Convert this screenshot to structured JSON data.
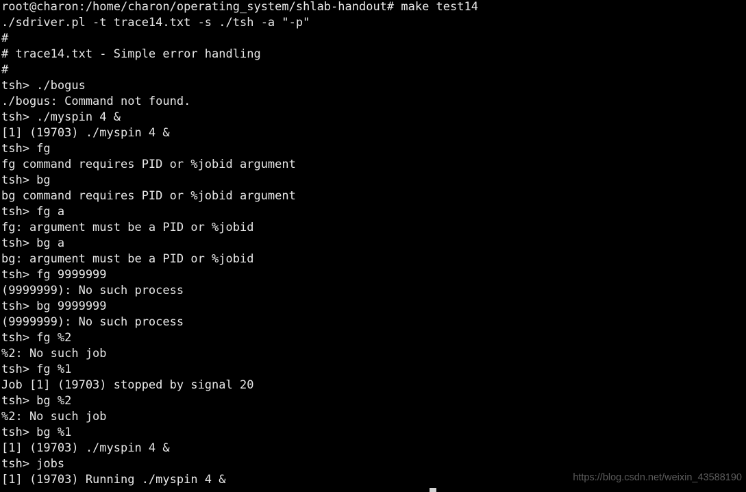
{
  "terminal": {
    "title": "root@charon: /home/charon/operating_system/shlab-handout",
    "colors": {
      "background": "#000000",
      "foreground": "#e8e8e8",
      "cursor": "#d4d4d4",
      "watermark": "#5c5c5c"
    },
    "prompt": "root@charon:/home/charon/operating_system/shlab-handout#",
    "shell_prompt": "tsh>",
    "command": "make test14",
    "job_pid": "19703",
    "job_id": "[1]",
    "lines": [
      "root@charon:/home/charon/operating_system/shlab-handout# make test14",
      "./sdriver.pl -t trace14.txt -s ./tsh -a \"-p\"",
      "#",
      "# trace14.txt - Simple error handling",
      "#",
      "tsh> ./bogus",
      "./bogus: Command not found.",
      "tsh> ./myspin 4 &",
      "[1] (19703) ./myspin 4 &",
      "tsh> fg",
      "fg command requires PID or %jobid argument",
      "tsh> bg",
      "bg command requires PID or %jobid argument",
      "tsh> fg a",
      "fg: argument must be a PID or %jobid",
      "tsh> bg a",
      "bg: argument must be a PID or %jobid",
      "tsh> fg 9999999",
      "(9999999): No such process",
      "tsh> bg 9999999",
      "(9999999): No such process",
      "tsh> fg %2",
      "%2: No such job",
      "tsh> fg %1",
      "Job [1] (19703) stopped by signal 20",
      "tsh> bg %2",
      "%2: No such job",
      "tsh> bg %1",
      "[1] (19703) ./myspin 4 &",
      "tsh> jobs",
      "[1] (19703) Running ./myspin 4 &"
    ]
  },
  "watermark": {
    "text": "https://blog.csdn.net/weixin_43588190"
  }
}
